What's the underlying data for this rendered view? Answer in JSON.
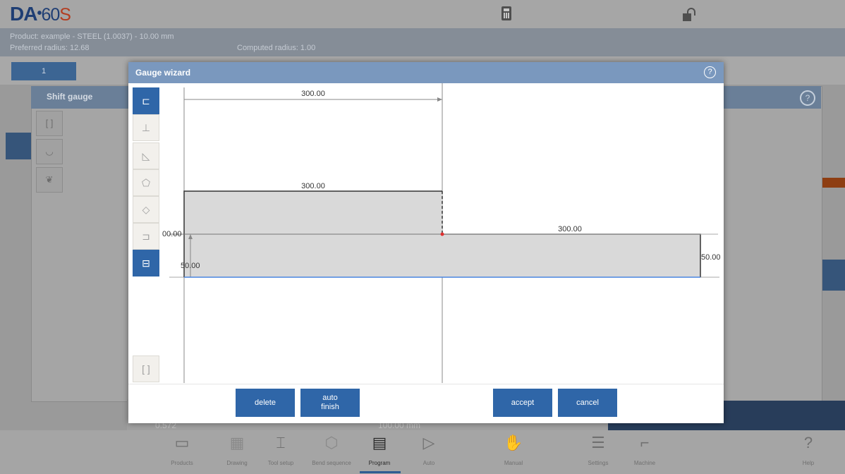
{
  "header": {
    "logo_brand": "DA",
    "logo_dot": "•",
    "logo_model": "60",
    "logo_suffix": "S",
    "calculator_icon": "calculator-icon",
    "lock_icon": "unlock-icon"
  },
  "info": {
    "product": "Product: example - STEEL (1.0037) - 10.00 mm",
    "preferred_radius": "Preferred radius: 12.68",
    "computed_radius": "Computed radius: 1.00"
  },
  "tabs": [
    {
      "label": "1"
    }
  ],
  "shift_gauge": {
    "title": "Shift gauge",
    "help": "?"
  },
  "bottom_strip": {
    "left_text": "0.572",
    "mid_text": "100.00 mm"
  },
  "dialog": {
    "title": "Gauge wizard",
    "help": "?",
    "buttons": {
      "delete": "delete",
      "auto_finish_line1": "auto",
      "auto_finish_line2": "finish",
      "accept": "accept",
      "cancel": "cancel"
    },
    "dimensions": {
      "top": "300.00",
      "left_part_width": "300.00",
      "right_part_width": "300.00",
      "left_height_label": "00.00",
      "left_part_height": "50.00",
      "right_part_height": "50.00"
    }
  },
  "nav": [
    {
      "label": "Products",
      "icon": "folder-icon"
    },
    {
      "label": "Drawing",
      "icon": "drawing-icon"
    },
    {
      "label": "Tool setup",
      "icon": "tool-setup-icon"
    },
    {
      "label": "Bend sequence",
      "icon": "bend-sequence-icon"
    },
    {
      "label": "Program",
      "icon": "program-icon"
    },
    {
      "label": "Auto",
      "icon": "play-icon"
    },
    {
      "label": "Manual",
      "icon": "hand-icon"
    },
    {
      "label": "Settings",
      "icon": "list-icon"
    },
    {
      "label": "Machine",
      "icon": "machine-icon"
    },
    {
      "label": "Help",
      "icon": "help-icon"
    }
  ],
  "colors": {
    "accent": "#2f66a8",
    "dialog_header": "#7a98be",
    "part_fill": "#d9d9d9",
    "baseline": "#4a86e0",
    "marker": "#e03030"
  }
}
